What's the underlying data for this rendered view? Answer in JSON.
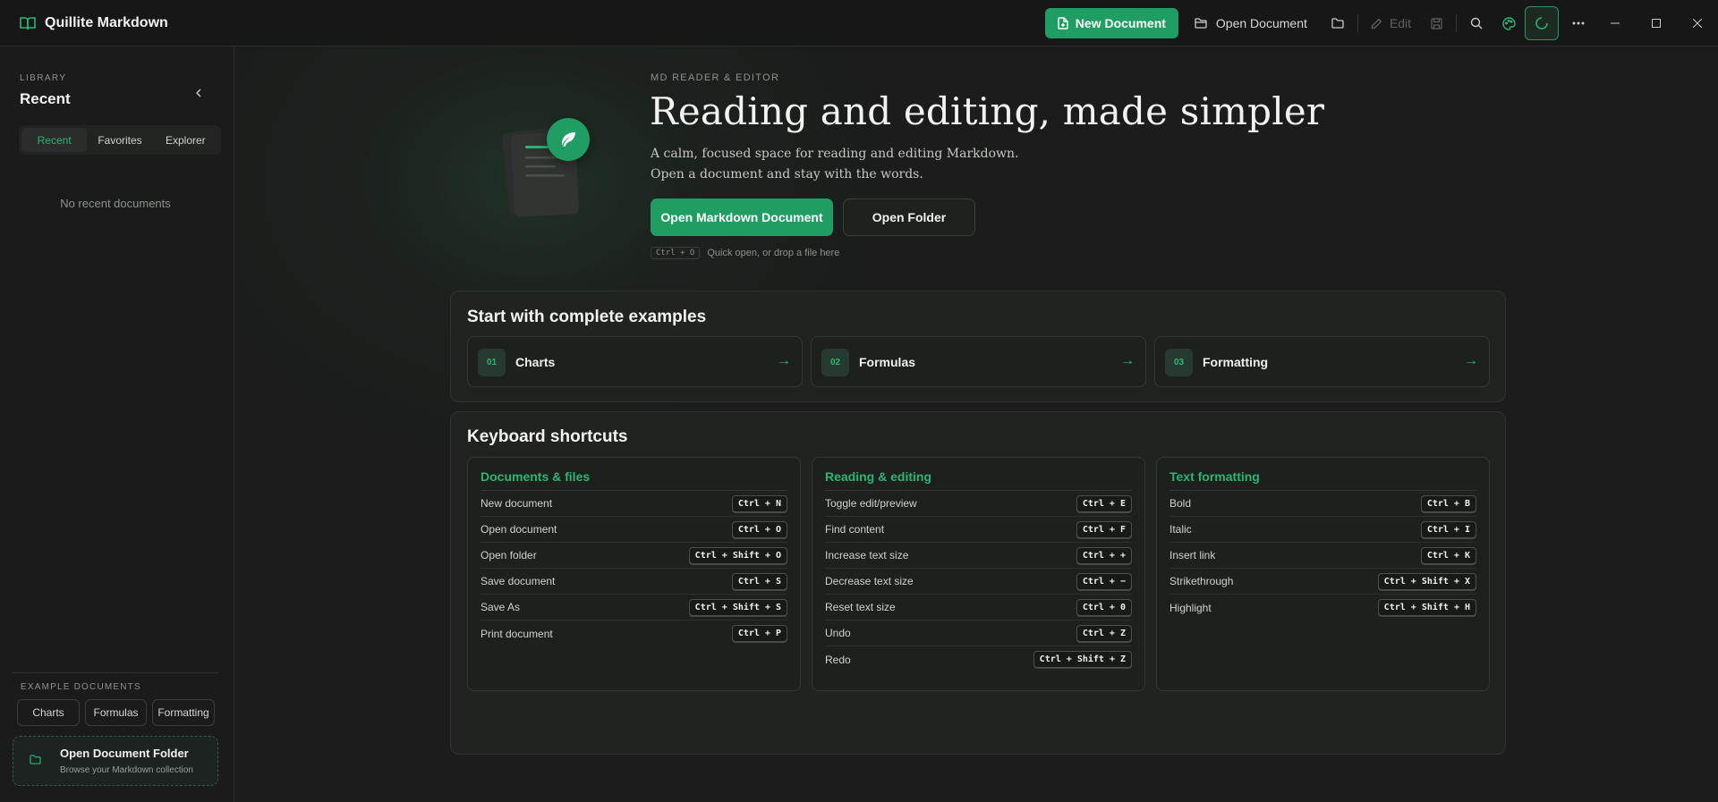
{
  "app": {
    "title": "Quillite Markdown"
  },
  "toolbar": {
    "new_document": "New Document",
    "open_document": "Open Document",
    "edit": "Edit"
  },
  "sidebar": {
    "section_label": "LIBRARY",
    "title": "Recent",
    "tabs": [
      {
        "label": "Recent",
        "active": true
      },
      {
        "label": "Favorites",
        "active": false
      },
      {
        "label": "Explorer",
        "active": false
      }
    ],
    "empty_message": "No recent documents",
    "examples_label": "EXAMPLE DOCUMENTS",
    "example_buttons": [
      "Charts",
      "Formulas",
      "Formatting"
    ],
    "folder_card": {
      "title": "Open Document Folder",
      "subtitle": "Browse your Markdown collection"
    }
  },
  "hero": {
    "eyebrow": "MD READER & EDITOR",
    "title": "Reading and editing, made simpler",
    "subtitle_line1": "A calm, focused space for reading and editing Markdown.",
    "subtitle_line2": "Open a document and stay with the words.",
    "primary_button": "Open Markdown Document",
    "secondary_button": "Open Folder",
    "hint_kbd": "Ctrl + O",
    "hint_text": "Quick open, or drop a file here"
  },
  "examples": {
    "title": "Start with complete examples",
    "items": [
      {
        "num": "01",
        "label": "Charts",
        "arrow": "→"
      },
      {
        "num": "02",
        "label": "Formulas",
        "arrow": "→"
      },
      {
        "num": "03",
        "label": "Formatting",
        "arrow": "→"
      }
    ]
  },
  "shortcuts": {
    "title": "Keyboard shortcuts",
    "groups": [
      {
        "title": "Documents & files",
        "rows": [
          {
            "label": "New document",
            "keys": "Ctrl + N"
          },
          {
            "label": "Open document",
            "keys": "Ctrl + O"
          },
          {
            "label": "Open folder",
            "keys": "Ctrl + Shift + O"
          },
          {
            "label": "Save document",
            "keys": "Ctrl + S"
          },
          {
            "label": "Save As",
            "keys": "Ctrl + Shift + S"
          },
          {
            "label": "Print document",
            "keys": "Ctrl + P"
          }
        ]
      },
      {
        "title": "Reading & editing",
        "rows": [
          {
            "label": "Toggle edit/preview",
            "keys": "Ctrl + E"
          },
          {
            "label": "Find content",
            "keys": "Ctrl + F"
          },
          {
            "label": "Increase text size",
            "keys": "Ctrl + +"
          },
          {
            "label": "Decrease text size",
            "keys": "Ctrl + −"
          },
          {
            "label": "Reset text size",
            "keys": "Ctrl + 0"
          },
          {
            "label": "Undo",
            "keys": "Ctrl + Z"
          },
          {
            "label": "Redo",
            "keys": "Ctrl + Shift + Z"
          }
        ]
      },
      {
        "title": "Text formatting",
        "rows": [
          {
            "label": "Bold",
            "keys": "Ctrl + B"
          },
          {
            "label": "Italic",
            "keys": "Ctrl + I"
          },
          {
            "label": "Insert link",
            "keys": "Ctrl + K"
          },
          {
            "label": "Strikethrough",
            "keys": "Ctrl + Shift + X"
          },
          {
            "label": "Highlight",
            "keys": "Ctrl + Shift + H"
          }
        ]
      }
    ]
  },
  "colors": {
    "accent": "#1f9d63",
    "accent_text": "#2bb574",
    "background": "#1b1c1b",
    "panel": "#212321"
  },
  "icons": {
    "brand": "book-open-icon",
    "new_document": "file-plus-icon",
    "open_document": "folder-icon",
    "toolbar": [
      "folder-icon",
      "pencil-icon",
      "save-icon",
      "search-icon",
      "palette-icon",
      "spinner-icon",
      "more-icon",
      "minimize-icon",
      "maximize-icon",
      "close-icon"
    ],
    "hero": "leaf-icon"
  }
}
